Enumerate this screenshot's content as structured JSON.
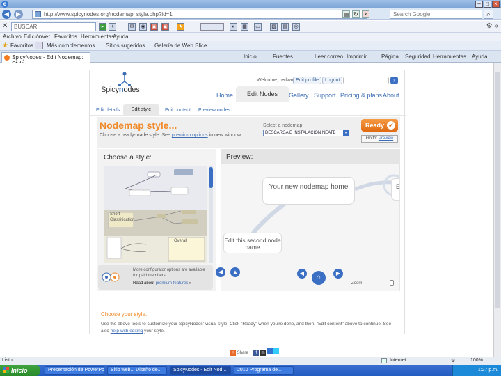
{
  "browser": {
    "url": "http://www.spicynodes.org/nodemap_style.php?id=1",
    "search_placeholder": "Search Google",
    "toolbar_search": "BUSCAR",
    "menu": [
      "Archivo",
      "Edición",
      "Ver",
      "Favoritos",
      "Herramientas",
      "Ayuda"
    ],
    "favorites_label": "Favoritos",
    "favorites": [
      "Más complementos",
      "Sitios sugeridos",
      "Galería de Web Slice"
    ],
    "tab_title": "SpicyNodes - Edit Nodemap: Style",
    "commands": [
      "Página",
      "Seguridad",
      "Herramientas",
      "Ayuda"
    ],
    "command_extra": [
      "Inicio",
      "Fuentes",
      "Leer correo",
      "Imprimir"
    ]
  },
  "site": {
    "logo_prefix": "Spicy",
    "logo_o": "n",
    "logo_suffix": "odes",
    "welcome": "Welcome, redvariy",
    "edit_profile": "Edit profile",
    "logout": "Logout",
    "nav": {
      "home": "Home",
      "edit_nodes": "Edit Nodes",
      "gallery": "Gallery",
      "support": "Support",
      "pricing": "Pricing & plans",
      "about": "About"
    },
    "subnav": {
      "edit_details": "Edit details",
      "edit_style": "Edit style",
      "edit_content": "Edit content",
      "preview_nodes": "Preview nodes"
    },
    "header": {
      "title": "Nodemap style...",
      "sub_before": "Choose a ready-made style. See ",
      "sub_link": "premium options",
      "sub_after": " in new window.",
      "select_label": "Select a nodemap:",
      "select_value": "DESCARGA E INSTALACION NEATB",
      "ready": "Ready",
      "goto_prefix": "Go to: ",
      "goto_link": "Preview"
    },
    "style_panel": {
      "title": "Choose a style:",
      "thumb_labels": [
        "Short",
        "Classification",
        "Overall"
      ],
      "promo_text": "More configurator options are available for paid members.",
      "promo_prefix": "Read about ",
      "promo_link": "premium features",
      "promo_suffix": " »"
    },
    "preview_panel": {
      "title": "Preview:",
      "node_main": "Your new nodemap home",
      "node_second": "Edit this second node name",
      "node_edge": "Ed",
      "zoom": "Zoom"
    },
    "choose": {
      "heading": "Choose your style.",
      "p1": "Use the above tools to customize your SpicyNodes' visual style. Click \"Ready\" when you're done, and then, \"Edit content\" above to continue. See also ",
      "p_link": "help with editing",
      "p2": " your style."
    },
    "share": "Share"
  },
  "status": {
    "left": "Listo",
    "zone": "Internet",
    "zoom": "100%"
  },
  "taskbar": {
    "start": "Inicio",
    "tasks": [
      "Presentación de PowerPoint",
      "Sitio web... Diseño de...",
      "SpicyNodes - Edit Nod...",
      "2010 Programa de..."
    ],
    "clock": "1:27 p.m."
  },
  "colors": {
    "accent_orange": "#f08a2a",
    "link_blue": "#3b6db5",
    "ready_button": "#e06a12"
  }
}
